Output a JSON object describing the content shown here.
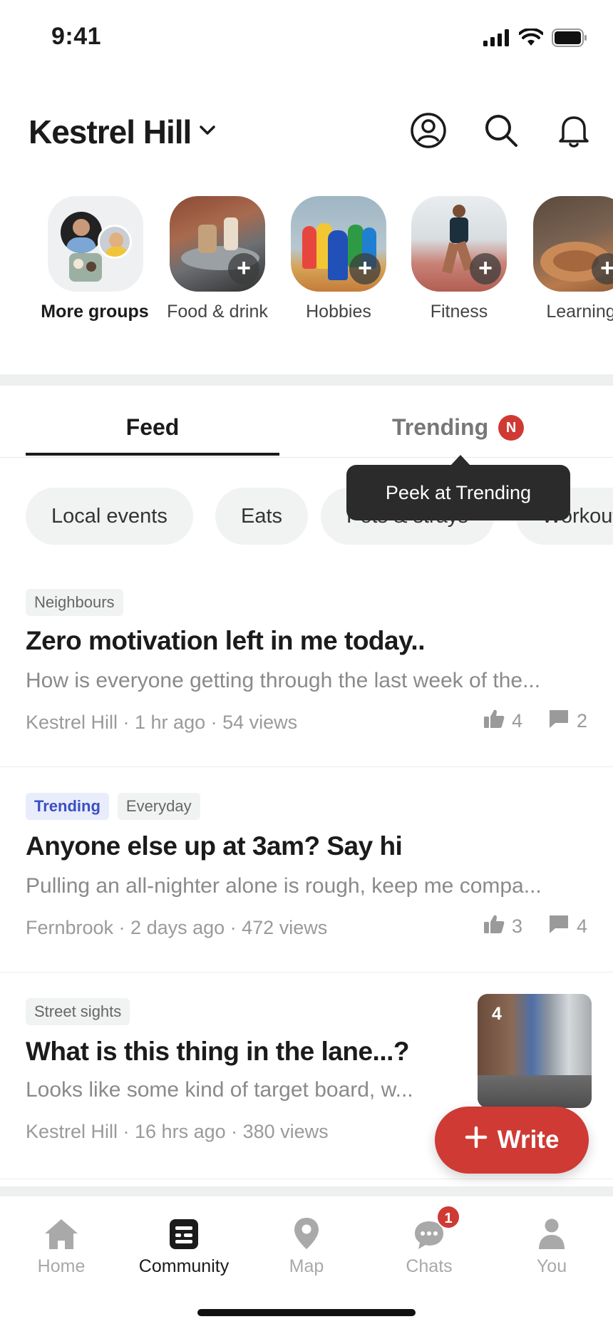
{
  "status_bar": {
    "time": "9:41"
  },
  "header": {
    "location": "Kestrel Hill"
  },
  "groups": [
    {
      "label": "More groups"
    },
    {
      "label": "Food & drink"
    },
    {
      "label": "Hobbies"
    },
    {
      "label": "Fitness"
    },
    {
      "label": "Learning"
    }
  ],
  "tabs": {
    "feed": "Feed",
    "trending": "Trending",
    "trending_badge": "N"
  },
  "tooltip": "Peek at Trending",
  "chips": [
    "Local events",
    "Eats",
    "Pets & strays",
    "Workouts"
  ],
  "posts": [
    {
      "tags": [
        "Neighbours"
      ],
      "title": "Zero motivation left in me today..",
      "excerpt": "How is everyone getting through the last week of the...",
      "meta": "Kestrel Hill · 1 hr ago · 54 views",
      "likes": "4",
      "comments": "2"
    },
    {
      "trend_tag": "Trending",
      "tags": [
        "Everyday"
      ],
      "title": "Anyone else up at 3am? Say hi",
      "excerpt": "Pulling an all-nighter alone is rough, keep me compa...",
      "meta": "Fernbrook · 2 days ago · 472 views",
      "likes": "3",
      "comments": "4"
    },
    {
      "tags": [
        "Street sights"
      ],
      "title": "What is this thing in the lane...?",
      "excerpt": "Looks like some kind of target board, w...",
      "meta": "Kestrel Hill · 16 hrs ago · 380 views",
      "image_count": "4"
    }
  ],
  "fab": {
    "label": "Write"
  },
  "bottom_nav": [
    {
      "label": "Home"
    },
    {
      "label": "Community"
    },
    {
      "label": "Map"
    },
    {
      "label": "Chats",
      "badge": "1"
    },
    {
      "label": "You"
    }
  ],
  "colors": {
    "accent": "#cf3a34",
    "trending_tag_text": "#3b4fc4",
    "trending_tag_bg": "#e9ecfb"
  }
}
